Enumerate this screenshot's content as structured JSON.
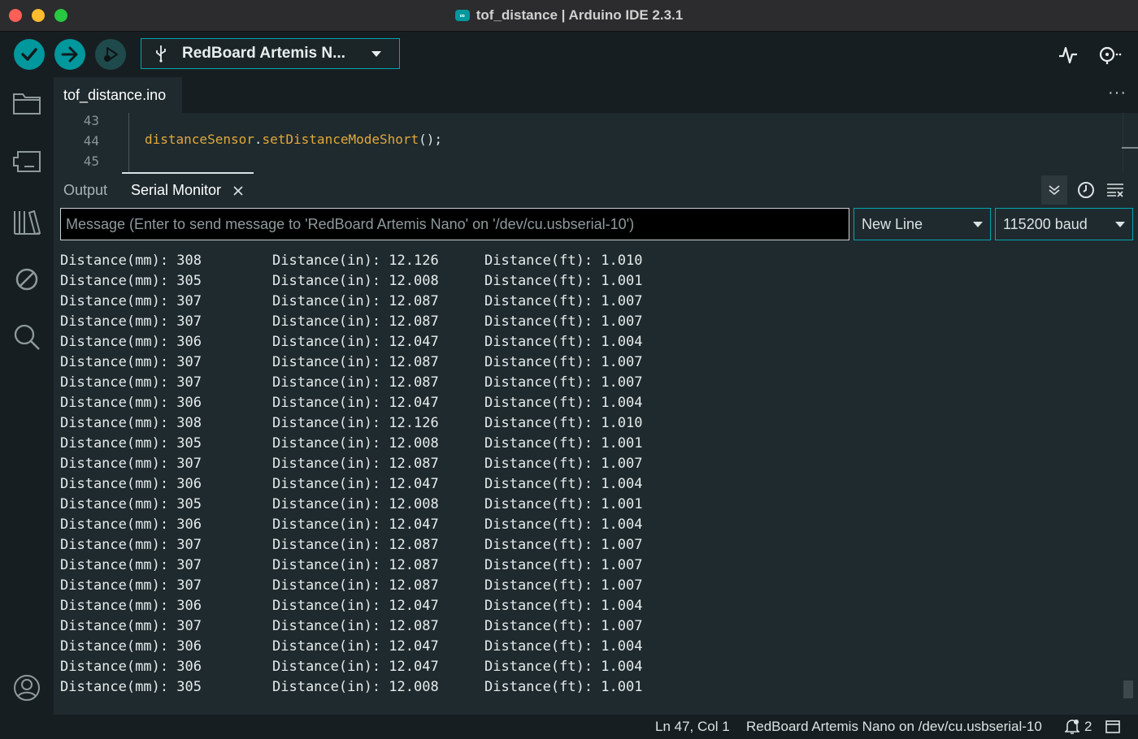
{
  "window": {
    "title": "tof_distance | Arduino IDE 2.3.1",
    "logo_text": "∞"
  },
  "toolbar": {
    "verify_icon": "check-icon",
    "upload_icon": "arrow-right-icon",
    "debug_icon": "debug-icon",
    "board_label": "RedBoard Artemis N...",
    "plotter_icon": "serial-plotter-icon",
    "monitor_icon": "serial-monitor-icon"
  },
  "editor": {
    "file_tab": "tof_distance.ino",
    "more_label": "···",
    "line_numbers": [
      "43",
      "44",
      "45"
    ],
    "code": {
      "object": "distanceSensor",
      "dot": ".",
      "method": "setDistanceModeShort",
      "tail": "();"
    }
  },
  "panel": {
    "tabs": {
      "output": "Output",
      "serial": "Serial Monitor"
    },
    "message_placeholder": "Message (Enter to send message to 'RedBoard Artemis Nano' on '/dev/cu.usbserial-10')",
    "line_ending": "New Line",
    "baud": "115200 baud"
  },
  "serial_rows": [
    [
      "Distance(mm): 308",
      "Distance(in): 12.126",
      "Distance(ft): 1.010"
    ],
    [
      "Distance(mm): 305",
      "Distance(in): 12.008",
      "Distance(ft): 1.001"
    ],
    [
      "Distance(mm): 307",
      "Distance(in): 12.087",
      "Distance(ft): 1.007"
    ],
    [
      "Distance(mm): 307",
      "Distance(in): 12.087",
      "Distance(ft): 1.007"
    ],
    [
      "Distance(mm): 306",
      "Distance(in): 12.047",
      "Distance(ft): 1.004"
    ],
    [
      "Distance(mm): 307",
      "Distance(in): 12.087",
      "Distance(ft): 1.007"
    ],
    [
      "Distance(mm): 307",
      "Distance(in): 12.087",
      "Distance(ft): 1.007"
    ],
    [
      "Distance(mm): 306",
      "Distance(in): 12.047",
      "Distance(ft): 1.004"
    ],
    [
      "Distance(mm): 308",
      "Distance(in): 12.126",
      "Distance(ft): 1.010"
    ],
    [
      "Distance(mm): 305",
      "Distance(in): 12.008",
      "Distance(ft): 1.001"
    ],
    [
      "Distance(mm): 307",
      "Distance(in): 12.087",
      "Distance(ft): 1.007"
    ],
    [
      "Distance(mm): 306",
      "Distance(in): 12.047",
      "Distance(ft): 1.004"
    ],
    [
      "Distance(mm): 305",
      "Distance(in): 12.008",
      "Distance(ft): 1.001"
    ],
    [
      "Distance(mm): 306",
      "Distance(in): 12.047",
      "Distance(ft): 1.004"
    ],
    [
      "Distance(mm): 307",
      "Distance(in): 12.087",
      "Distance(ft): 1.007"
    ],
    [
      "Distance(mm): 307",
      "Distance(in): 12.087",
      "Distance(ft): 1.007"
    ],
    [
      "Distance(mm): 307",
      "Distance(in): 12.087",
      "Distance(ft): 1.007"
    ],
    [
      "Distance(mm): 306",
      "Distance(in): 12.047",
      "Distance(ft): 1.004"
    ],
    [
      "Distance(mm): 307",
      "Distance(in): 12.087",
      "Distance(ft): 1.007"
    ],
    [
      "Distance(mm): 306",
      "Distance(in): 12.047",
      "Distance(ft): 1.004"
    ],
    [
      "Distance(mm): 306",
      "Distance(in): 12.047",
      "Distance(ft): 1.004"
    ],
    [
      "Distance(mm): 305",
      "Distance(in): 12.008",
      "Distance(ft): 1.001"
    ]
  ],
  "status": {
    "cursor": "Ln 47, Col 1",
    "board": "RedBoard Artemis Nano on /dev/cu.usbserial-10",
    "notifications": "2"
  },
  "colors": {
    "accent": "#00979d",
    "background": "#171e21",
    "editor_bg": "#1f2a2e",
    "code_highlight": "#e1a83a"
  }
}
